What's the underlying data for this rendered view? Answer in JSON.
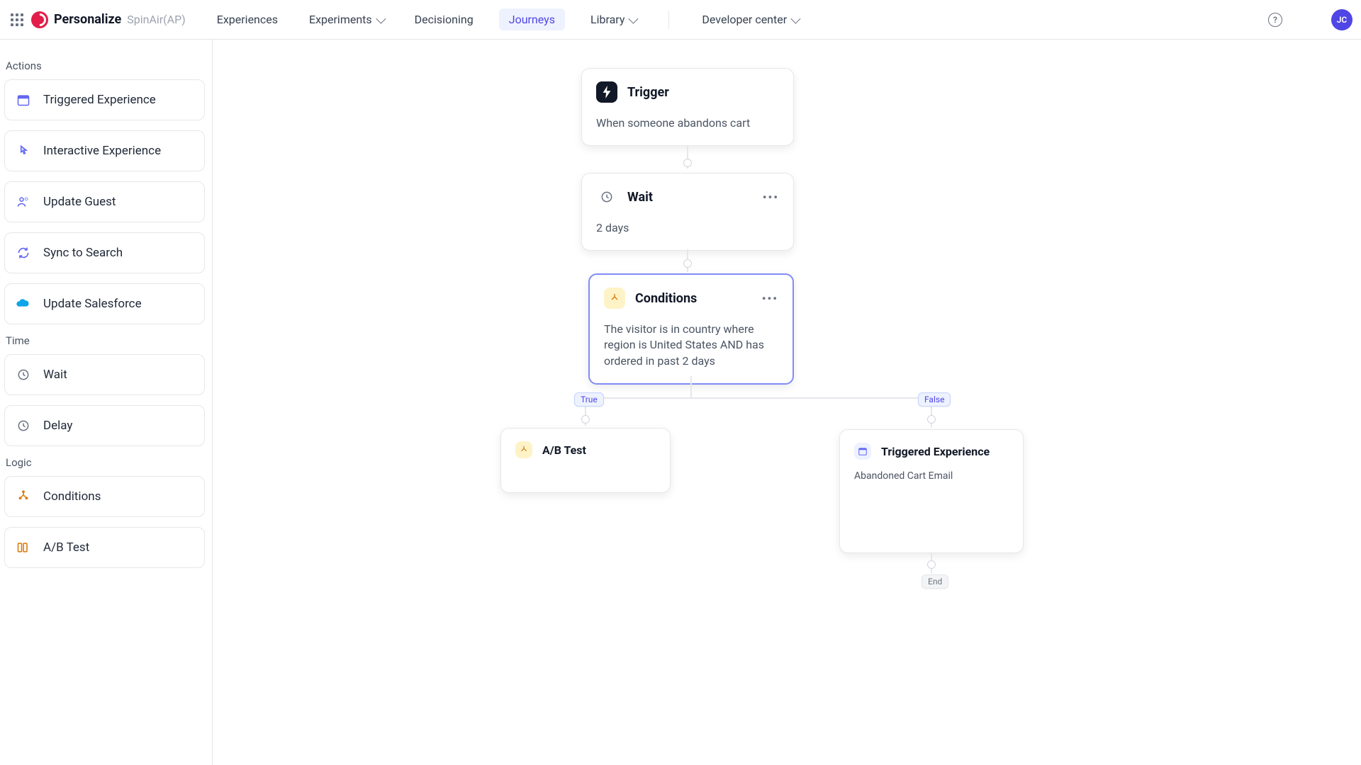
{
  "header": {
    "brand_title": "Personalize",
    "brand_subtitle": "SpinAir(AP)",
    "nav": {
      "experiences": "Experiences",
      "experiments": "Experiments",
      "decisioning": "Decisioning",
      "journeys": "Journeys",
      "library": "Library",
      "developer_center": "Developer center"
    },
    "avatar_initials": "JC"
  },
  "sidebar": {
    "groups": {
      "actions": {
        "title": "Actions",
        "items": {
          "triggered_experience": "Triggered Experience",
          "interactive_experience": "Interactive Experience",
          "update_guest": "Update Guest",
          "sync_to_search": "Sync to Search",
          "update_salesforce": "Update Salesforce"
        }
      },
      "time": {
        "title": "Time",
        "items": {
          "wait": "Wait",
          "delay": "Delay"
        }
      },
      "logic": {
        "title": "Logic",
        "items": {
          "conditions": "Conditions",
          "ab_test": "A/B Test"
        }
      }
    }
  },
  "canvas": {
    "trigger": {
      "title": "Trigger",
      "body": "When someone abandons cart"
    },
    "wait": {
      "title": "Wait",
      "body": "2 days"
    },
    "conditions": {
      "title": "Conditions",
      "body": "The visitor is in country where region is United States AND has ordered in past 2 days"
    },
    "abtest": {
      "title": "A/B Test"
    },
    "triggered_exp": {
      "title": "Triggered Experience",
      "body": "Abandoned Cart Email"
    },
    "badges": {
      "true": "True",
      "false": "False",
      "end": "End"
    },
    "more_glyph": "•••"
  },
  "colors": {
    "indigo": "#4f46e5",
    "indigo_bg": "#eef2ff"
  }
}
